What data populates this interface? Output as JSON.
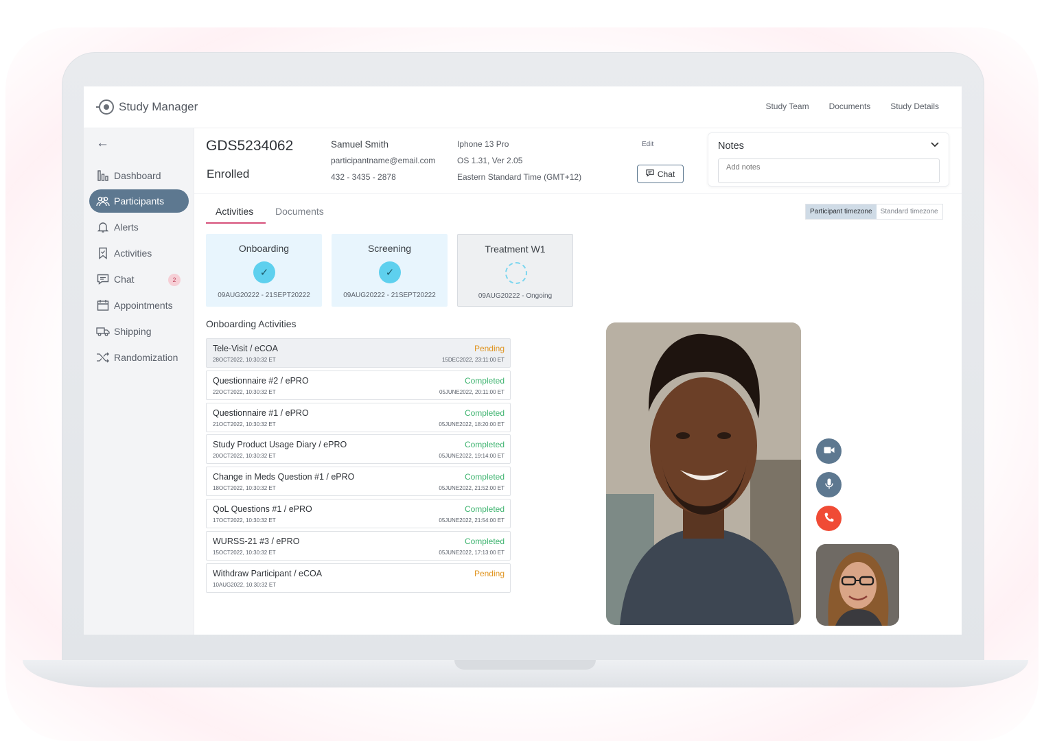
{
  "app": {
    "title": "Study Manager"
  },
  "topnav": [
    "Study Team",
    "Documents",
    "Study Details"
  ],
  "sidebar": {
    "items": [
      {
        "label": "Dashboard",
        "icon": "bar-chart-icon"
      },
      {
        "label": "Participants",
        "icon": "users-icon",
        "active": true
      },
      {
        "label": "Alerts",
        "icon": "bell-icon"
      },
      {
        "label": "Activities",
        "icon": "bookmark-icon"
      },
      {
        "label": "Chat",
        "icon": "chat-icon",
        "badge": "2"
      },
      {
        "label": "Appointments",
        "icon": "calendar-icon"
      },
      {
        "label": "Shipping",
        "icon": "truck-icon"
      },
      {
        "label": "Randomization",
        "icon": "shuffle-icon"
      }
    ]
  },
  "participant": {
    "id": "GDS5234062",
    "status": "Enrolled",
    "name": "Samuel Smith",
    "email": "participantname@email.com",
    "phone": "432 - 3435 - 2878",
    "device": "Iphone 13 Pro",
    "os": "OS 1.31, Ver 2.05",
    "timezone": "Eastern Standard Time (GMT+12)",
    "edit_label": "Edit",
    "chat_label": "Chat"
  },
  "notes": {
    "title": "Notes",
    "placeholder": "Add notes"
  },
  "tabs": [
    {
      "label": "Activities",
      "active": true
    },
    {
      "label": "Documents",
      "active": false
    }
  ],
  "tz_toggle": {
    "on": "Participant timezone",
    "off": "Standard timezone"
  },
  "stages": [
    {
      "title": "Onboarding",
      "dates": "09AUG20222 - 21SEPT20222",
      "state": "done"
    },
    {
      "title": "Screening",
      "dates": "09AUG20222 - 21SEPT20222",
      "state": "done"
    },
    {
      "title": "Treatment W1",
      "dates": "09AUG20222 - Ongoing",
      "state": "ongoing"
    }
  ],
  "activities_title": "Onboarding Activities",
  "activities": [
    {
      "name": "Tele-Visit / eCOA",
      "date": "28OCT2022, 10:30:32 ET",
      "status": "Pending",
      "end": "15DEC2022, 23:11:00 ET"
    },
    {
      "name": "Questionnaire #2 / ePRO",
      "date": "22OCT2022, 10:30:32 ET",
      "status": "Completed",
      "end": "05JUNE2022, 20:11:00 ET"
    },
    {
      "name": "Questionnaire #1 / ePRO",
      "date": "21OCT2022, 10:30:32 ET",
      "status": "Completed",
      "end": "05JUNE2022, 18:20:00 ET"
    },
    {
      "name": "Study Product Usage Diary / ePRO",
      "date": "20OCT2022, 10:30:32 ET",
      "status": "Completed",
      "end": "05JUNE2022, 19:14:00 ET"
    },
    {
      "name": "Change in Meds Question #1 / ePRO",
      "date": "18OCT2022, 10:30:32 ET",
      "status": "Completed",
      "end": "05JUNE2022, 21:52:00 ET"
    },
    {
      "name": "QoL Questions #1 / ePRO",
      "date": "17OCT2022, 10:30:32 ET",
      "status": "Completed",
      "end": "05JUNE2022, 21:54:00 ET"
    },
    {
      "name": "WURSS-21 #3 / ePRO",
      "date": "15OCT2022, 10:30:32 ET",
      "status": "Completed",
      "end": "05JUNE2022, 17:13:00 ET"
    },
    {
      "name": "Withdraw Participant / eCOA",
      "date": "10AUG2022, 10:30:32 ET",
      "status": "Pending",
      "end": ""
    }
  ],
  "colors": {
    "accent": "#5d7890",
    "pending": "#e0941f",
    "completed": "#3fb470",
    "tab_underline": "#d6507a",
    "end_call": "#f04b35"
  }
}
